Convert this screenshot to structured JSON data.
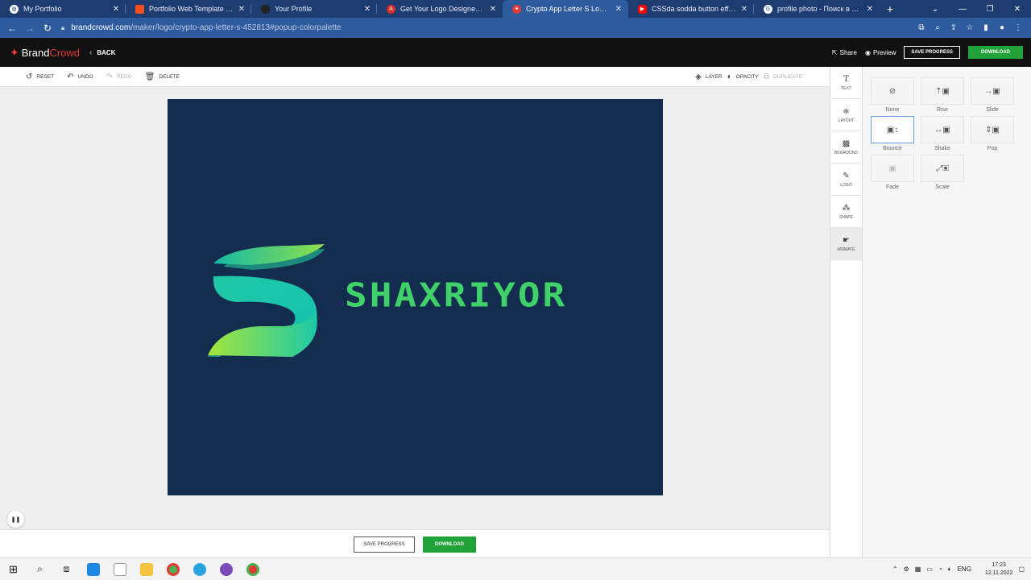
{
  "browser": {
    "tabs": [
      {
        "title": "My Portfolio",
        "icon": "globe-icon",
        "color": "#ffffff"
      },
      {
        "title": "Portfolio Web Template (Comm",
        "icon": "figma-icon",
        "color": "#f24e1e"
      },
      {
        "title": "Your Profile",
        "icon": "github-icon",
        "color": "#222222"
      },
      {
        "title": "Get Your Logo Designed - Seek",
        "icon": "seek-icon",
        "color": "#d93025"
      },
      {
        "title": "Crypto App Letter S Logo | Bran",
        "icon": "brandcrowd-icon",
        "color": "#e53935",
        "active": true
      },
      {
        "title": "CSSda sodda button effect - Yo",
        "icon": "youtube-icon",
        "color": "#ff0000"
      },
      {
        "title": "profile photo - Поиск в Google",
        "icon": "google-icon",
        "color": "#ffffff"
      }
    ],
    "url_host": "brandcrowd.com",
    "url_path": "/maker/logo/crypto-app-letter-s-452813#popup-colorpalette"
  },
  "header": {
    "brand_first": "Brand",
    "brand_second": "Crowd",
    "back": "BACK",
    "share": "Share",
    "preview": "Preview",
    "save_progress": "SAVE PROGRESS",
    "download": "DOWNLOAD"
  },
  "toolbar": {
    "reset": "RESET",
    "undo": "UNDO",
    "redo": "REDO",
    "delete": "DELETE",
    "layer": "LAYER",
    "opacity": "OPACITY",
    "duplicate": "DUPLICATE"
  },
  "canvas": {
    "background": "#132d4f",
    "brand_text": "SHAXRIYOR",
    "text_color": "#41d16b"
  },
  "bottom": {
    "save_progress": "SAVE PROGRESS",
    "download": "DOWNLOAD"
  },
  "rail": [
    {
      "label": "TEXT",
      "icon": "text-icon"
    },
    {
      "label": "LAYOUT",
      "icon": "layout-icon"
    },
    {
      "label": "BKGROUND",
      "icon": "background-icon"
    },
    {
      "label": "LOGO",
      "icon": "logo-icon"
    },
    {
      "label": "SHAPE",
      "icon": "shape-icon"
    },
    {
      "label": "ANIMATE",
      "icon": "animate-icon",
      "active": true
    }
  ],
  "animations": [
    {
      "label": "None"
    },
    {
      "label": "Rise"
    },
    {
      "label": "Slide"
    },
    {
      "label": "Bounce",
      "selected": true
    },
    {
      "label": "Shake"
    },
    {
      "label": "Pop"
    },
    {
      "label": "Fade"
    },
    {
      "label": "Scale"
    }
  ],
  "taskbar": {
    "language": "ENG",
    "time": "17:23",
    "date": "12.11.2022"
  }
}
